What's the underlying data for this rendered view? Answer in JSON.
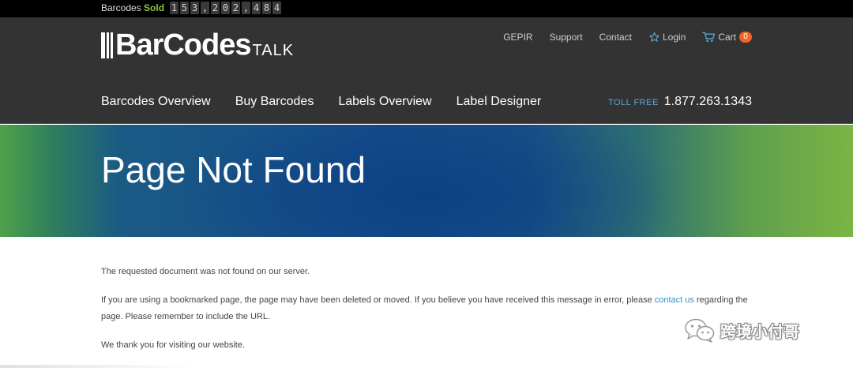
{
  "counter": {
    "label_prefix": "Barcodes",
    "label_highlight": "Sold",
    "digits": [
      "1",
      "5",
      "3",
      ",",
      "2",
      "0",
      "2",
      ",",
      "4",
      "8",
      "4"
    ]
  },
  "logo": {
    "main": "BarCodes",
    "sub": "TALK"
  },
  "util_nav": {
    "gepir": "GEPIR",
    "support": "Support",
    "contact": "Contact",
    "login": "Login",
    "cart": "Cart",
    "cart_count": "0"
  },
  "main_nav": {
    "items": [
      "Barcodes Overview",
      "Buy Barcodes",
      "Labels Overview",
      "Label Designer"
    ]
  },
  "toll": {
    "label": "TOLL FREE",
    "number": "1.877.263.1343"
  },
  "hero": {
    "title": "Page Not Found"
  },
  "content": {
    "p1": "The requested document was not found on our server.",
    "p2_before": "If you are using a bookmarked page, the page may have been deleted or moved. If you believe you have received this message in error, please ",
    "p2_link": "contact us",
    "p2_after": " regarding the page. Please remember to include the URL.",
    "p3": "We thank you for visiting our website."
  },
  "watermark": {
    "text": "跨境小付哥",
    "icon": "wechat-icon"
  },
  "colors": {
    "header_bg": "#333333",
    "accent_green": "#8cc63f",
    "badge_orange": "#f26522",
    "link_blue": "#3a8fc8",
    "icon_blue": "#5aa7d6"
  }
}
